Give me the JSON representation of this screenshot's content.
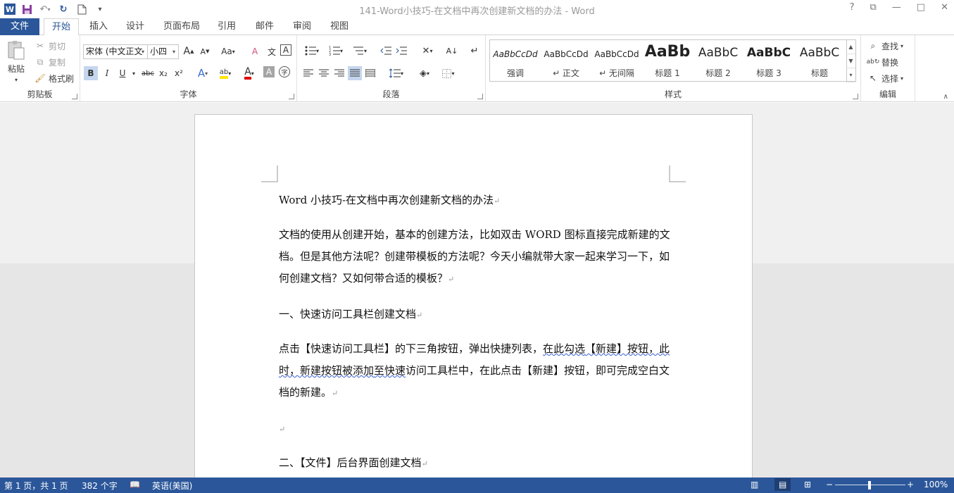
{
  "window": {
    "title": "141-Word小技巧-在文档中再次创建新文档的办法 - Word",
    "help": "?",
    "controls": [
      "?",
      "⧉",
      "—",
      "□",
      "✕"
    ]
  },
  "qat": {
    "word_icon": "W",
    "save_icon": "💾",
    "undo_icon": "↶",
    "redo_icon": "↻",
    "new_icon": "🗋",
    "more": "▾"
  },
  "tabs": {
    "file": "文件",
    "home": "开始",
    "insert": "插入",
    "design": "设计",
    "layout": "页面布局",
    "references": "引用",
    "mailings": "邮件",
    "review": "审阅",
    "view": "视图"
  },
  "clipboard": {
    "paste": "粘贴",
    "cut": "剪切",
    "copy": "复制",
    "format_painter": "格式刷",
    "label": "剪贴板"
  },
  "font": {
    "name": "宋体 (中文正文",
    "size": "小四",
    "label": "字体",
    "bold": "B",
    "italic": "I",
    "underline": "U",
    "strike": "abc",
    "sub": "x₂",
    "sup": "x²",
    "grow": "A",
    "shrink": "A",
    "case": "Aa",
    "clear": "A",
    "phonetic": "文",
    "border": "A",
    "effects": "A",
    "highlight": "ab",
    "color": "A",
    "shade": "A",
    "enclose": "字"
  },
  "paragraph": {
    "label": "段落"
  },
  "styles": {
    "label": "样式",
    "items": [
      {
        "preview": "AaBbCcDd",
        "name": "强调"
      },
      {
        "preview": "AaBbCcDd",
        "name": "↵ 正文"
      },
      {
        "preview": "AaBbCcDd",
        "name": "↵ 无间隔"
      },
      {
        "preview": "AaBb",
        "name": "标题 1"
      },
      {
        "preview": "AaBbC",
        "name": "标题 2"
      },
      {
        "preview": "AaBbC",
        "name": "标题 3"
      },
      {
        "preview": "AaBbC",
        "name": "标题"
      }
    ]
  },
  "editing": {
    "find": "查找",
    "replace": "替换",
    "select": "选择",
    "label": "编辑"
  },
  "document": {
    "title": "Word 小技巧-在文档中再次创建新文档的办法",
    "p1": "文档的使用从创建开始，基本的创建方法，比如双击 WORD 图标直接完成新建的文档。但是其他方法呢？创建带模板的方法呢？今天小编就带大家一起来学习一下，如何创建文档？又如何带合适的模板？",
    "h1": "一、快速访问工具栏创建文档",
    "p2a": "点击【快速访问工具栏】的下三角按钮，弹出快捷列表，",
    "p2b": "在此勾选",
    "p2c": "【新建】按钮，此时，新建按钮被添加",
    "p2d": "至快速",
    "p2e": "访问工具栏中，在此点击【新建】按钮，即可完成空白文档的新建。",
    "h2": "二、【文件】后台界面创建文档",
    "para_mark": "↵"
  },
  "status": {
    "page": "第 1 页，共 1 页",
    "words": "382 个字",
    "language": "英语(美国)",
    "zoom": "100%",
    "zoom_minus": "−",
    "zoom_plus": "+"
  }
}
